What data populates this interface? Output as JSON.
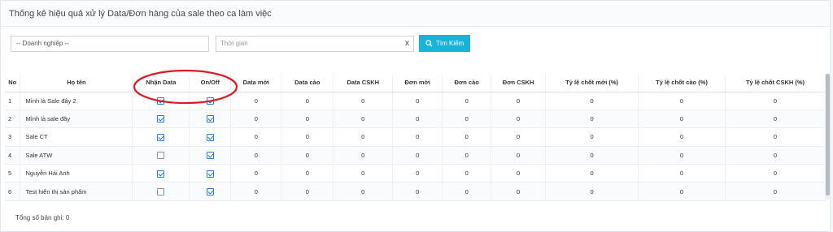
{
  "panel": {
    "title": "Thống kê hiệu quả xử lý Data/Đơn hàng của sale theo ca làm việc"
  },
  "filters": {
    "company_select": "-- Doanh nghiệp --",
    "date_placeholder": "Thời gian",
    "clear_label": "x",
    "search_label": "Tìm Kiếm"
  },
  "table": {
    "headers": [
      "No",
      "Họ tên",
      "Nhận Data",
      "On/Off",
      "Data mới",
      "Data cào",
      "Data CSKH",
      "Đơn mới",
      "Đơn cào",
      "Đơn CSKH",
      "Tỷ lệ chốt mới (%)",
      "Tỷ lệ chốt cào (%)",
      "Tỷ lệ chốt CSKH (%)"
    ],
    "rows": [
      {
        "no": "1",
        "name": "Mình là Sale đây 2",
        "nhan_data": true,
        "on_off": true,
        "data_moi": "0",
        "data_cao": "0",
        "data_cskh": "0",
        "don_moi": "0",
        "don_cao": "0",
        "don_cskh": "0",
        "tl_moi": "0",
        "tl_cao": "0",
        "tl_cskh": "0"
      },
      {
        "no": "2",
        "name": "Mình là sale đây",
        "nhan_data": true,
        "on_off": true,
        "data_moi": "0",
        "data_cao": "0",
        "data_cskh": "0",
        "don_moi": "0",
        "don_cao": "0",
        "don_cskh": "0",
        "tl_moi": "0",
        "tl_cao": "0",
        "tl_cskh": "0"
      },
      {
        "no": "3",
        "name": "Sale CT",
        "nhan_data": true,
        "on_off": true,
        "data_moi": "0",
        "data_cao": "0",
        "data_cskh": "0",
        "don_moi": "0",
        "don_cao": "0",
        "don_cskh": "0",
        "tl_moi": "0",
        "tl_cao": "0",
        "tl_cskh": "0"
      },
      {
        "no": "4",
        "name": "Sale ATW",
        "nhan_data": false,
        "on_off": true,
        "data_moi": "0",
        "data_cao": "0",
        "data_cskh": "0",
        "don_moi": "0",
        "don_cao": "0",
        "don_cskh": "0",
        "tl_moi": "0",
        "tl_cao": "0",
        "tl_cskh": "0"
      },
      {
        "no": "5",
        "name": "Nguyễn Hải Anh",
        "nhan_data": true,
        "on_off": true,
        "data_moi": "0",
        "data_cao": "0",
        "data_cskh": "0",
        "don_moi": "0",
        "don_cao": "0",
        "don_cskh": "0",
        "tl_moi": "0",
        "tl_cao": "0",
        "tl_cskh": "0"
      },
      {
        "no": "6",
        "name": "Test hiển thị sản phẩm",
        "nhan_data": false,
        "on_off": true,
        "data_moi": "0",
        "data_cao": "0",
        "data_cskh": "0",
        "don_moi": "0",
        "don_cao": "0",
        "don_cskh": "0",
        "tl_moi": "0",
        "tl_cao": "0",
        "tl_cskh": "0"
      }
    ]
  },
  "footer": {
    "total_records": "Tổng số bản ghi: 0"
  },
  "colors": {
    "accent": "#17b3d9",
    "annotation": "#d91c24",
    "checkbox": "#2a7fd8"
  },
  "icons": {
    "search": "search-icon"
  }
}
